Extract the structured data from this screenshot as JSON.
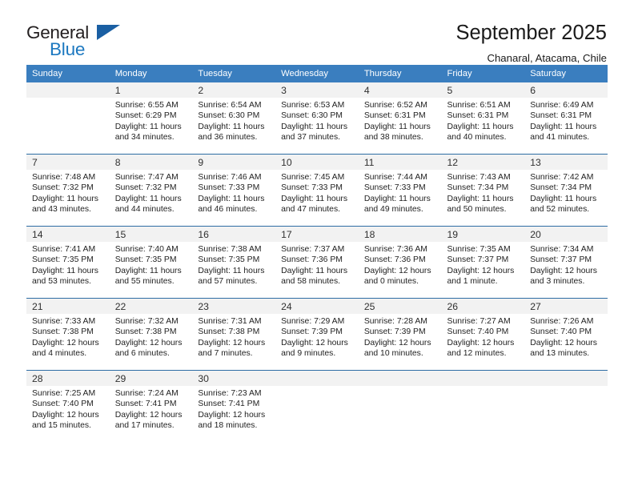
{
  "logo": {
    "text_primary": "General",
    "text_secondary": "Blue",
    "triangle_color": "#1a5fa3",
    "secondary_color": "#1c78c0"
  },
  "header": {
    "title": "September 2025",
    "subtitle": "Chanaral, Atacama, Chile"
  },
  "calendar": {
    "header_bg": "#3a7ebf",
    "weekdays": [
      "Sunday",
      "Monday",
      "Tuesday",
      "Wednesday",
      "Thursday",
      "Friday",
      "Saturday"
    ],
    "weeks": [
      [
        {
          "day": "",
          "blank": true
        },
        {
          "day": "1",
          "sunrise": "Sunrise: 6:55 AM",
          "sunset": "Sunset: 6:29 PM",
          "daylight1": "Daylight: 11 hours",
          "daylight2": "and 34 minutes."
        },
        {
          "day": "2",
          "sunrise": "Sunrise: 6:54 AM",
          "sunset": "Sunset: 6:30 PM",
          "daylight1": "Daylight: 11 hours",
          "daylight2": "and 36 minutes."
        },
        {
          "day": "3",
          "sunrise": "Sunrise: 6:53 AM",
          "sunset": "Sunset: 6:30 PM",
          "daylight1": "Daylight: 11 hours",
          "daylight2": "and 37 minutes."
        },
        {
          "day": "4",
          "sunrise": "Sunrise: 6:52 AM",
          "sunset": "Sunset: 6:31 PM",
          "daylight1": "Daylight: 11 hours",
          "daylight2": "and 38 minutes."
        },
        {
          "day": "5",
          "sunrise": "Sunrise: 6:51 AM",
          "sunset": "Sunset: 6:31 PM",
          "daylight1": "Daylight: 11 hours",
          "daylight2": "and 40 minutes."
        },
        {
          "day": "6",
          "sunrise": "Sunrise: 6:49 AM",
          "sunset": "Sunset: 6:31 PM",
          "daylight1": "Daylight: 11 hours",
          "daylight2": "and 41 minutes."
        }
      ],
      [
        {
          "day": "7",
          "sunrise": "Sunrise: 7:48 AM",
          "sunset": "Sunset: 7:32 PM",
          "daylight1": "Daylight: 11 hours",
          "daylight2": "and 43 minutes."
        },
        {
          "day": "8",
          "sunrise": "Sunrise: 7:47 AM",
          "sunset": "Sunset: 7:32 PM",
          "daylight1": "Daylight: 11 hours",
          "daylight2": "and 44 minutes."
        },
        {
          "day": "9",
          "sunrise": "Sunrise: 7:46 AM",
          "sunset": "Sunset: 7:33 PM",
          "daylight1": "Daylight: 11 hours",
          "daylight2": "and 46 minutes."
        },
        {
          "day": "10",
          "sunrise": "Sunrise: 7:45 AM",
          "sunset": "Sunset: 7:33 PM",
          "daylight1": "Daylight: 11 hours",
          "daylight2": "and 47 minutes."
        },
        {
          "day": "11",
          "sunrise": "Sunrise: 7:44 AM",
          "sunset": "Sunset: 7:33 PM",
          "daylight1": "Daylight: 11 hours",
          "daylight2": "and 49 minutes."
        },
        {
          "day": "12",
          "sunrise": "Sunrise: 7:43 AM",
          "sunset": "Sunset: 7:34 PM",
          "daylight1": "Daylight: 11 hours",
          "daylight2": "and 50 minutes."
        },
        {
          "day": "13",
          "sunrise": "Sunrise: 7:42 AM",
          "sunset": "Sunset: 7:34 PM",
          "daylight1": "Daylight: 11 hours",
          "daylight2": "and 52 minutes."
        }
      ],
      [
        {
          "day": "14",
          "sunrise": "Sunrise: 7:41 AM",
          "sunset": "Sunset: 7:35 PM",
          "daylight1": "Daylight: 11 hours",
          "daylight2": "and 53 minutes."
        },
        {
          "day": "15",
          "sunrise": "Sunrise: 7:40 AM",
          "sunset": "Sunset: 7:35 PM",
          "daylight1": "Daylight: 11 hours",
          "daylight2": "and 55 minutes."
        },
        {
          "day": "16",
          "sunrise": "Sunrise: 7:38 AM",
          "sunset": "Sunset: 7:35 PM",
          "daylight1": "Daylight: 11 hours",
          "daylight2": "and 57 minutes."
        },
        {
          "day": "17",
          "sunrise": "Sunrise: 7:37 AM",
          "sunset": "Sunset: 7:36 PM",
          "daylight1": "Daylight: 11 hours",
          "daylight2": "and 58 minutes."
        },
        {
          "day": "18",
          "sunrise": "Sunrise: 7:36 AM",
          "sunset": "Sunset: 7:36 PM",
          "daylight1": "Daylight: 12 hours",
          "daylight2": "and 0 minutes."
        },
        {
          "day": "19",
          "sunrise": "Sunrise: 7:35 AM",
          "sunset": "Sunset: 7:37 PM",
          "daylight1": "Daylight: 12 hours",
          "daylight2": "and 1 minute."
        },
        {
          "day": "20",
          "sunrise": "Sunrise: 7:34 AM",
          "sunset": "Sunset: 7:37 PM",
          "daylight1": "Daylight: 12 hours",
          "daylight2": "and 3 minutes."
        }
      ],
      [
        {
          "day": "21",
          "sunrise": "Sunrise: 7:33 AM",
          "sunset": "Sunset: 7:38 PM",
          "daylight1": "Daylight: 12 hours",
          "daylight2": "and 4 minutes."
        },
        {
          "day": "22",
          "sunrise": "Sunrise: 7:32 AM",
          "sunset": "Sunset: 7:38 PM",
          "daylight1": "Daylight: 12 hours",
          "daylight2": "and 6 minutes."
        },
        {
          "day": "23",
          "sunrise": "Sunrise: 7:31 AM",
          "sunset": "Sunset: 7:38 PM",
          "daylight1": "Daylight: 12 hours",
          "daylight2": "and 7 minutes."
        },
        {
          "day": "24",
          "sunrise": "Sunrise: 7:29 AM",
          "sunset": "Sunset: 7:39 PM",
          "daylight1": "Daylight: 12 hours",
          "daylight2": "and 9 minutes."
        },
        {
          "day": "25",
          "sunrise": "Sunrise: 7:28 AM",
          "sunset": "Sunset: 7:39 PM",
          "daylight1": "Daylight: 12 hours",
          "daylight2": "and 10 minutes."
        },
        {
          "day": "26",
          "sunrise": "Sunrise: 7:27 AM",
          "sunset": "Sunset: 7:40 PM",
          "daylight1": "Daylight: 12 hours",
          "daylight2": "and 12 minutes."
        },
        {
          "day": "27",
          "sunrise": "Sunrise: 7:26 AM",
          "sunset": "Sunset: 7:40 PM",
          "daylight1": "Daylight: 12 hours",
          "daylight2": "and 13 minutes."
        }
      ],
      [
        {
          "day": "28",
          "sunrise": "Sunrise: 7:25 AM",
          "sunset": "Sunset: 7:40 PM",
          "daylight1": "Daylight: 12 hours",
          "daylight2": "and 15 minutes."
        },
        {
          "day": "29",
          "sunrise": "Sunrise: 7:24 AM",
          "sunset": "Sunset: 7:41 PM",
          "daylight1": "Daylight: 12 hours",
          "daylight2": "and 17 minutes."
        },
        {
          "day": "30",
          "sunrise": "Sunrise: 7:23 AM",
          "sunset": "Sunset: 7:41 PM",
          "daylight1": "Daylight: 12 hours",
          "daylight2": "and 18 minutes."
        },
        {
          "day": "",
          "blank": true
        },
        {
          "day": "",
          "blank": true
        },
        {
          "day": "",
          "blank": true
        },
        {
          "day": "",
          "blank": true
        }
      ]
    ]
  }
}
